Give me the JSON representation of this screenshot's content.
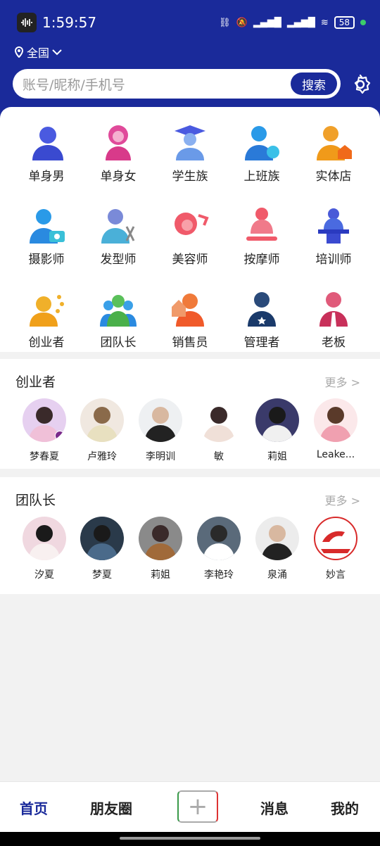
{
  "status": {
    "time": "1:59:57",
    "battery": "58"
  },
  "header": {
    "region": "全国",
    "search_placeholder": "账号/昵称/手机号",
    "search_button": "搜索"
  },
  "categories": [
    {
      "label": "单身男",
      "icon": "single-man-icon"
    },
    {
      "label": "单身女",
      "icon": "single-woman-icon"
    },
    {
      "label": "学生族",
      "icon": "student-icon"
    },
    {
      "label": "上班族",
      "icon": "office-worker-icon"
    },
    {
      "label": "实体店",
      "icon": "store-icon"
    },
    {
      "label": "摄影师",
      "icon": "photographer-icon"
    },
    {
      "label": "发型师",
      "icon": "hairstylist-icon"
    },
    {
      "label": "美容师",
      "icon": "beautician-icon"
    },
    {
      "label": "按摩师",
      "icon": "masseur-icon"
    },
    {
      "label": "培训师",
      "icon": "trainer-icon"
    },
    {
      "label": "创业者",
      "icon": "entrepreneur-icon"
    },
    {
      "label": "团队长",
      "icon": "team-leader-icon"
    },
    {
      "label": "销售员",
      "icon": "salesperson-icon"
    },
    {
      "label": "管理者",
      "icon": "manager-icon"
    },
    {
      "label": "老板",
      "icon": "boss-icon"
    }
  ],
  "entrepreneurs": {
    "title": "创业者",
    "more": "更多 >",
    "people": [
      "梦春夏",
      "卢雅玲",
      "李明训",
      "敏",
      "莉姐",
      "Leake..."
    ]
  },
  "team_leaders": {
    "title": "团队长",
    "more": "更多 >",
    "people": [
      "汐夏",
      "梦夏",
      "莉姐",
      "李艳玲",
      "泉涌",
      "妙言"
    ]
  },
  "tabs": {
    "home": "首页",
    "moments": "朋友圈",
    "add": "+",
    "messages": "消息",
    "mine": "我的"
  },
  "colors": {
    "brand": "#1a2a9a",
    "background": "#f2f2f2"
  }
}
